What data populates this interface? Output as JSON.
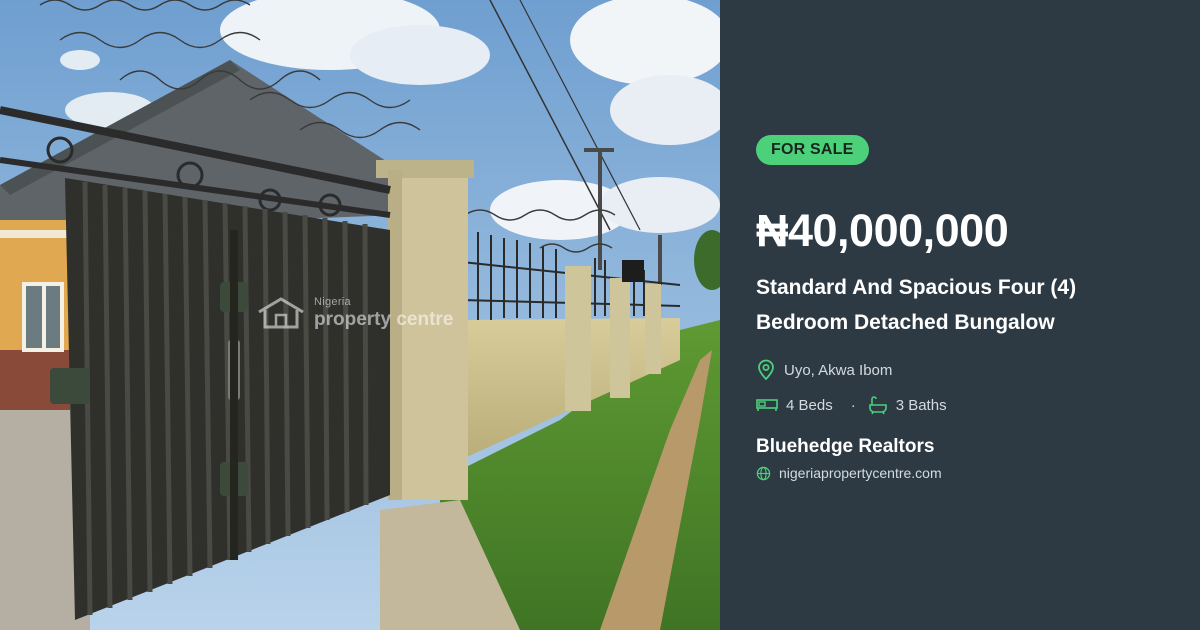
{
  "listing": {
    "status_badge": "FOR SALE",
    "price": "₦40,000,000",
    "title": "Standard And Spacious Four (4) Bedroom Detached Bungalow",
    "location": "Uyo, Akwa Ibom",
    "beds": "4 Beds",
    "baths": "3 Baths",
    "agent": "Bluehedge Realtors",
    "website": "nigeriapropertycentre.com"
  },
  "watermark": {
    "line1": "Nigeria",
    "line2": "property centre"
  },
  "icons": {
    "location": "map-pin-icon",
    "beds": "bed-icon",
    "baths": "bathtub-icon",
    "website": "globe-icon"
  },
  "colors": {
    "panel_background": "#2d3a44",
    "accent_green": "#4cd07a",
    "text_primary": "#ffffff",
    "text_secondary": "#d3dae0"
  }
}
